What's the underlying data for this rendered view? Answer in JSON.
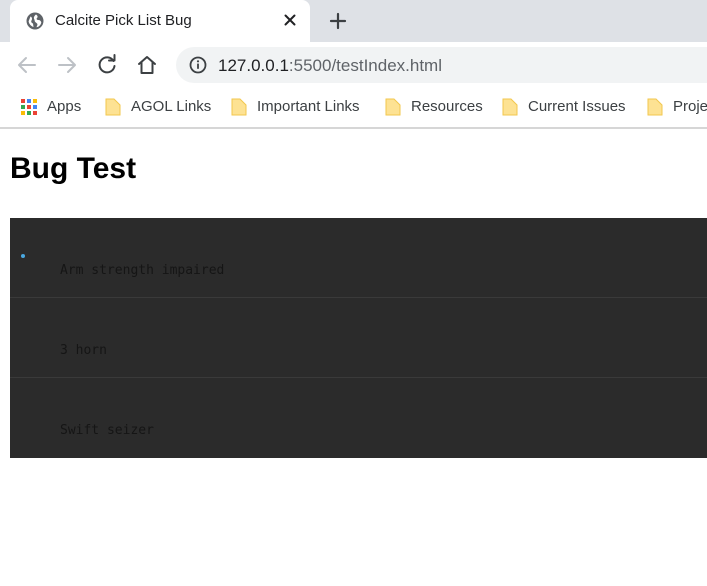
{
  "browser": {
    "tab": {
      "title": "Calcite Pick List Bug",
      "favicon": "globe-icon"
    },
    "new_tab_icon": "plus-icon",
    "url": {
      "host": "127.0.0.1",
      "rest": ":5500/testIndex.html"
    }
  },
  "bookmarks": [
    {
      "label": "Apps",
      "icon": "apps-grid-icon"
    },
    {
      "label": "AGOL Links",
      "icon": "folder-icon"
    },
    {
      "label": "Important Links",
      "icon": "folder-icon"
    },
    {
      "label": "Resources",
      "icon": "folder-icon"
    },
    {
      "label": "Current Issues",
      "icon": "folder-icon"
    },
    {
      "label": "Proje",
      "icon": "folder-icon"
    }
  ],
  "page": {
    "title": "Bug Test",
    "pick_list": {
      "items": [
        {
          "label": "Arm strength impaired",
          "selected": true
        },
        {
          "label": "3 horn",
          "selected": false
        },
        {
          "label": "Swift seizer",
          "selected": false
        }
      ],
      "colors": {
        "background": "#2b2b2b",
        "text": "#151515",
        "indicator": "#4aa8e0"
      }
    }
  }
}
